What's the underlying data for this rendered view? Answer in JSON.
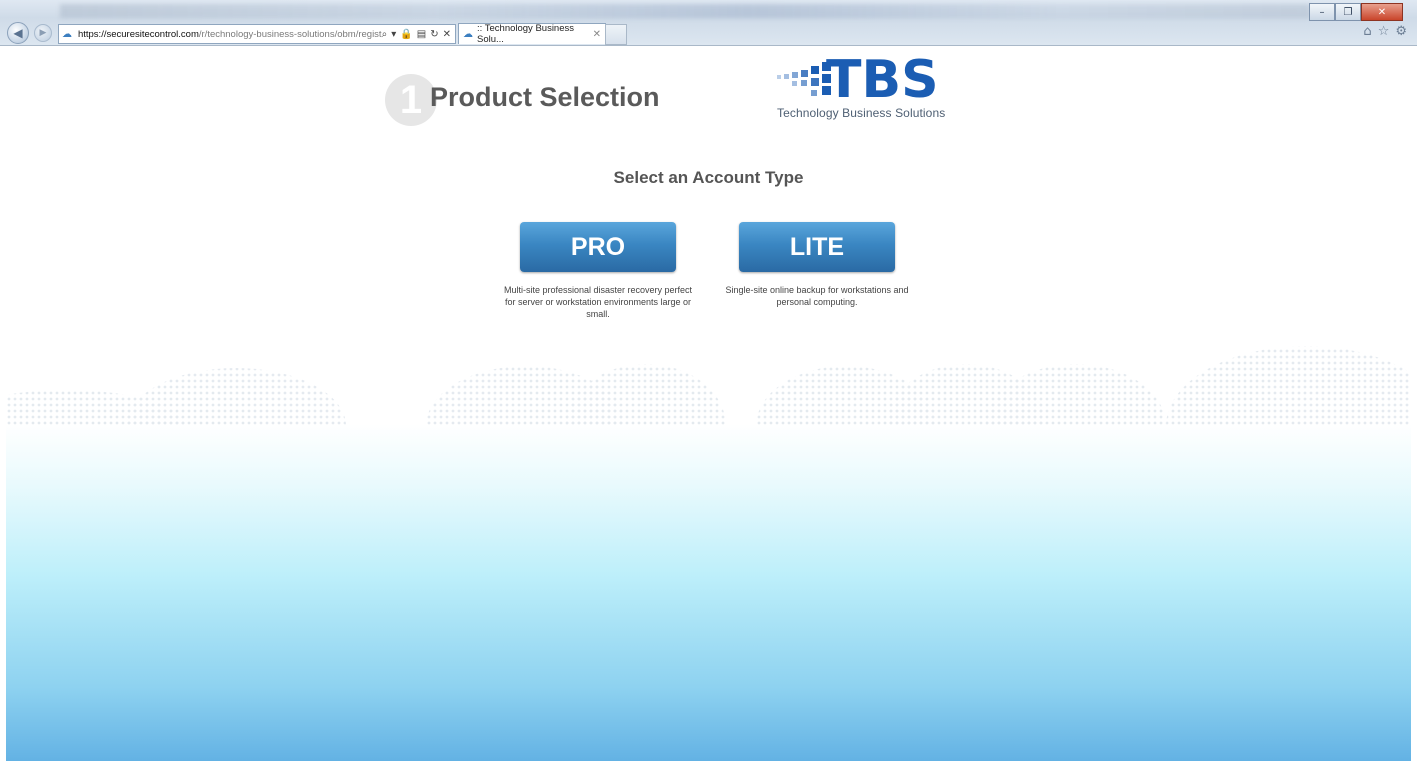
{
  "browser": {
    "url_host": "https://securesitecontrol.com",
    "url_path": "/r/technology-business-solutions/obm/register",
    "tab_title": ":: Technology Business Solu...",
    "window_controls": [
      "minimize-icon",
      "restore-icon",
      "close-icon"
    ],
    "toolbar_icons": [
      "home-icon",
      "star-icon",
      "gear-icon"
    ]
  },
  "header": {
    "step_number": "1",
    "title": "Product Selection"
  },
  "logo": {
    "wordmark": "TBS",
    "tagline": "Technology Business Solutions"
  },
  "main": {
    "subtitle": "Select an Account Type",
    "plans": [
      {
        "label": "PRO",
        "description": "Multi-site professional disaster recovery perfect for server or workstation environments large or small."
      },
      {
        "label": "LITE",
        "description": "Single-site online backup for workstations and personal computing."
      }
    ]
  },
  "colors": {
    "button_blue": "#3a86c2",
    "logo_blue": "#1b5db3",
    "title_gray": "#5a5a5a",
    "sky_bottom": "#63b2e4"
  }
}
